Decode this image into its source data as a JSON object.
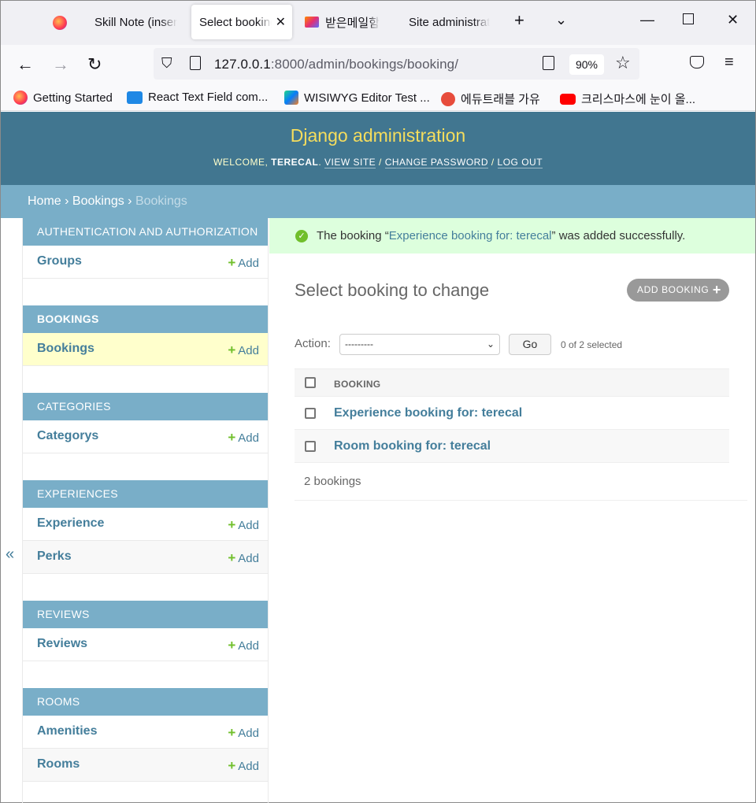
{
  "browser": {
    "tabs": [
      {
        "label": "Skill Note (inser"
      },
      {
        "label": "Select booking to change"
      },
      {
        "label": "받은메일함"
      },
      {
        "label": "Site administrat"
      }
    ],
    "url_host": "127.0.0.1",
    "url_path": ":8000/admin/bookings/booking/",
    "zoom": "90%",
    "bookmarks": [
      {
        "label": "Getting Started"
      },
      {
        "label": "React Text Field com..."
      },
      {
        "label": "WISIWYG Editor Test ..."
      },
      {
        "label": "에듀트래블 가유"
      },
      {
        "label": "크리스마스에 눈이 올..."
      }
    ]
  },
  "header": {
    "title": "Django administration",
    "welcome": "Welcome,",
    "user": "terecal",
    "view_site": "View site",
    "change_password": "Change password",
    "logout": "Log out"
  },
  "breadcrumbs": {
    "home": "Home",
    "app": "Bookings",
    "current": "Bookings"
  },
  "sidebar": {
    "add_label": "Add",
    "collapse": "«",
    "modules": [
      {
        "caption": "Authentication and Authorization",
        "items": [
          {
            "name": "Groups"
          }
        ]
      },
      {
        "caption": "Bookings",
        "items": [
          {
            "name": "Bookings"
          }
        ]
      },
      {
        "caption": "Categories",
        "items": [
          {
            "name": "Categorys"
          }
        ]
      },
      {
        "caption": "Experiences",
        "items": [
          {
            "name": "Experience"
          },
          {
            "name": "Perks"
          }
        ]
      },
      {
        "caption": "Reviews",
        "items": [
          {
            "name": "Reviews"
          }
        ]
      },
      {
        "caption": "Rooms",
        "items": [
          {
            "name": "Amenities"
          },
          {
            "name": "Rooms"
          }
        ]
      }
    ]
  },
  "message": {
    "prefix": "The booking “",
    "link": "Experience booking for: terecal",
    "suffix": "” was added successfully."
  },
  "main": {
    "title": "Select booking to change",
    "add_button": "Add booking",
    "action_label": "Action:",
    "action_value": "---------",
    "go": "Go",
    "selected": "0 of 2 selected",
    "column": "Booking",
    "rows": [
      "Experience booking for: terecal",
      "Room booking for: terecal"
    ],
    "count": "2 bookings"
  },
  "colors": {
    "header": "#417690",
    "breadcrumbs": "#79aec8",
    "title": "#f5dd5d",
    "link": "#447e9b",
    "success": "#dfd"
  }
}
